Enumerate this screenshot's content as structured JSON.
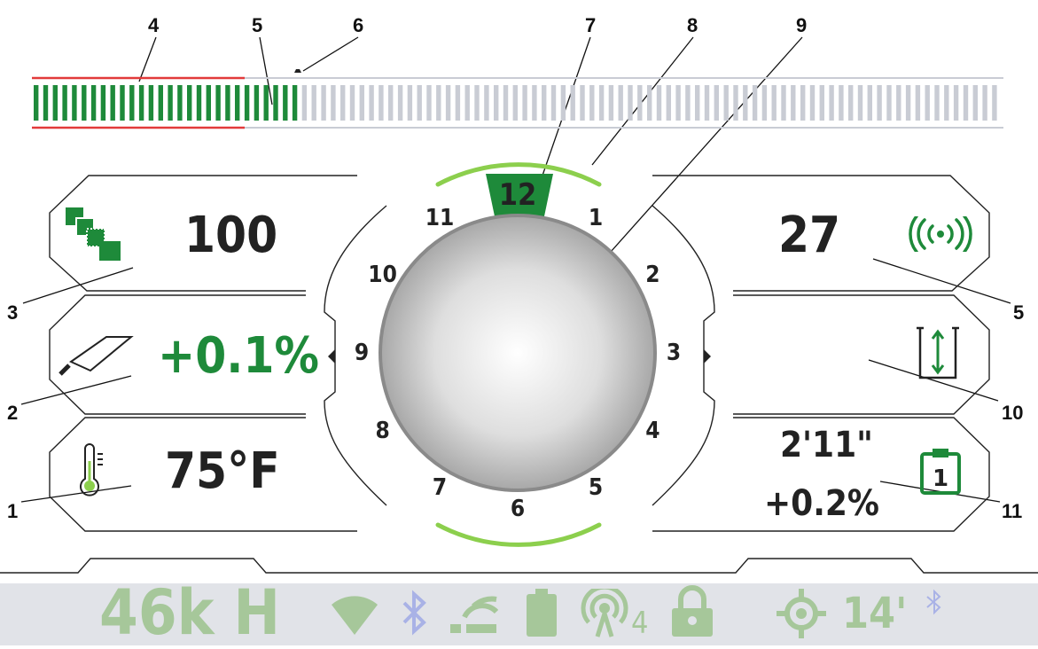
{
  "callouts": [
    "1",
    "2",
    "3",
    "4",
    "5",
    "6",
    "7",
    "8",
    "9",
    "10",
    "11",
    "5"
  ],
  "left_panel": {
    "count_value": "100",
    "slope_value": "+0.1%",
    "temperature_value": "75°F"
  },
  "right_panel": {
    "signal_value": "27",
    "depth_value": "",
    "stored_depth": "2'11\"",
    "stored_pitch": "+0.2%"
  },
  "clock_dial": {
    "numbers": [
      "12",
      "1",
      "2",
      "3",
      "4",
      "5",
      "6",
      "7",
      "8",
      "9",
      "10",
      "11"
    ],
    "highlighted": "12"
  },
  "signal_bar": {
    "filled_segments": 28,
    "total_segments": 101,
    "fill_color": "#1e8a3a",
    "empty_color": "#c9ccd4",
    "limit_line_color": "#e23a3a"
  },
  "status_bar": {
    "frequency": "46k H",
    "range": "14'",
    "channel": "4",
    "icons": [
      "wifi-icon",
      "bluetooth-icon",
      "link-icon",
      "battery-icon",
      "beacon-icon",
      "lock-icon",
      "target-icon",
      "small-bluetooth-icon"
    ]
  },
  "colors": {
    "accent_green": "#1e8a3a",
    "light_green": "#8ccf4d",
    "faded_green": "#a6c79a",
    "faded_blue": "#a9b2e6",
    "status_bg": "#e1e3e8"
  }
}
